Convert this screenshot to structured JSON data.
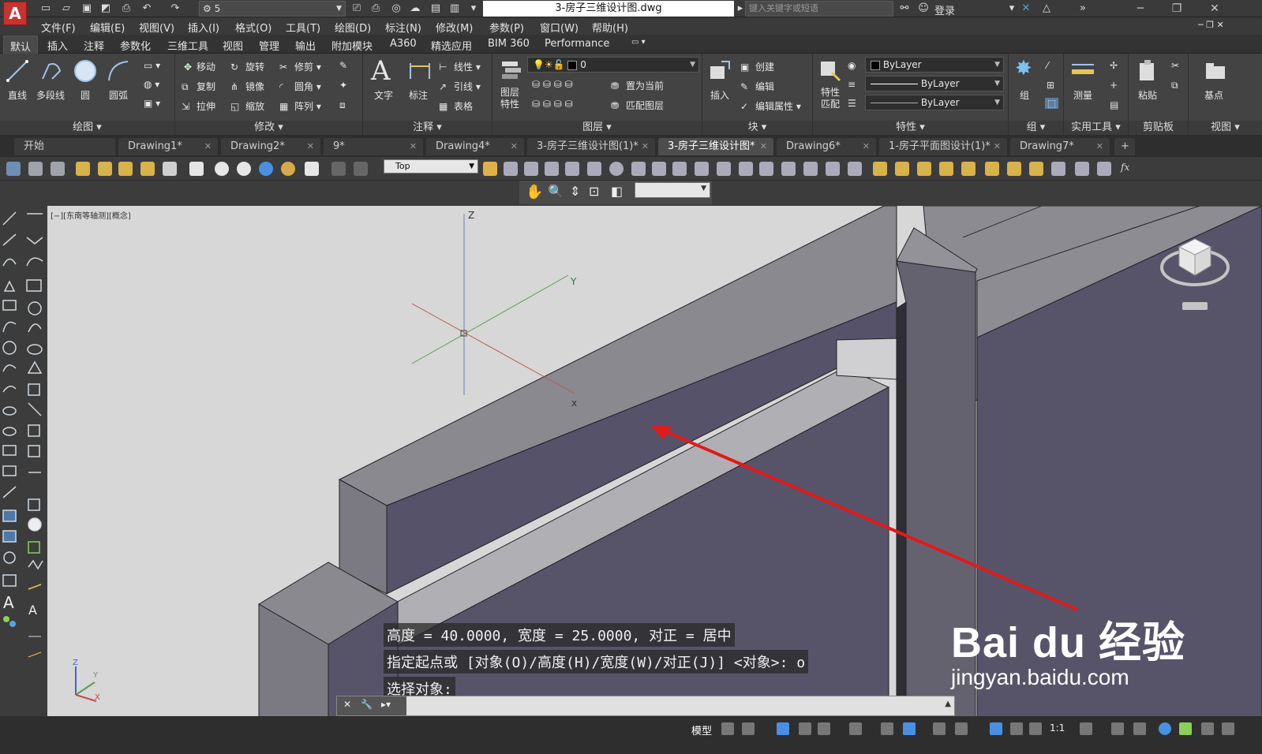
{
  "app": {
    "logo_letter": "A",
    "workspace": "5",
    "file_title": "3-房子三维设计图.dwg",
    "search_placeholder": "键入关键字或短语",
    "login": "登录"
  },
  "menu": [
    "文件(F)",
    "编辑(E)",
    "视图(V)",
    "插入(I)",
    "格式(O)",
    "工具(T)",
    "绘图(D)",
    "标注(N)",
    "修改(M)",
    "参数(P)",
    "窗口(W)",
    "帮助(H)"
  ],
  "ribbon_tabs": [
    "默认",
    "插入",
    "注释",
    "参数化",
    "三维工具",
    "视图",
    "管理",
    "输出",
    "附加模块",
    "A360",
    "精选应用",
    "BIM 360",
    "Performance"
  ],
  "ribbon": {
    "draw": {
      "title": "绘图",
      "line": "直线",
      "polyline": "多段线",
      "circle": "圆",
      "arc": "圆弧"
    },
    "modify": {
      "title": "修改",
      "move": "移动",
      "rotate": "旋转",
      "trim": "修剪",
      "copy": "复制",
      "mirror": "镜像",
      "fillet": "圆角",
      "stretch": "拉伸",
      "scale": "缩放",
      "array": "阵列"
    },
    "annotation": {
      "title": "注释",
      "text": "文字",
      "dimension": "标注",
      "linear": "线性",
      "leader": "引线",
      "table": "表格"
    },
    "layers": {
      "title": "图层",
      "layer_props": "图层\n特性",
      "layer_current": "0",
      "make_current": "置为当前",
      "match_layer": "匹配图层"
    },
    "block": {
      "title": "块",
      "insert": "插入",
      "create": "创建",
      "edit": "编辑",
      "edit_attr": "编辑属性"
    },
    "properties": {
      "title": "特性",
      "match": "特性\n匹配",
      "color": "ByLayer",
      "linetype": "ByLayer",
      "lineweight": "ByLayer"
    },
    "groups": {
      "title": "组",
      "group": "组"
    },
    "utilities": {
      "title": "实用工具",
      "measure": "测量"
    },
    "clipboard": {
      "title": "剪贴板",
      "paste": "粘贴"
    },
    "view": {
      "title": "视图",
      "base": "基点"
    }
  },
  "doc_tabs": [
    {
      "label": "开始",
      "active": false
    },
    {
      "label": "Drawing1*",
      "active": false
    },
    {
      "label": "Drawing2*",
      "active": false
    },
    {
      "label": "9*",
      "active": false
    },
    {
      "label": "Drawing4*",
      "active": false
    },
    {
      "label": "3-房子三维设计图(1)*",
      "active": false
    },
    {
      "label": "3-房子三维设计图*",
      "active": true
    },
    {
      "label": "Drawing6*",
      "active": false
    },
    {
      "label": "1-房子平面图设计(1)*",
      "active": false
    },
    {
      "label": "Drawing7*",
      "active": false
    }
  ],
  "toolbar": {
    "view_name": "Top"
  },
  "viewport": {
    "label": "[−][东南等轴测][概念]",
    "axis_z": "Z",
    "axis_y": "Y",
    "ucs_z": "Z",
    "ucs_y": "Y",
    "ucs_x": "X"
  },
  "command": {
    "history": [
      "高度 = 40.0000, 宽度 = 25.0000, 对正 = 居中",
      "指定起点或 [对象(O)/高度(H)/宽度(W)/对正(J)] <对象>: o",
      "选择对象:"
    ],
    "input": ""
  },
  "status": {
    "model": "模型",
    "scale": "1:1"
  },
  "watermark": {
    "brand": "Bai du 经验",
    "url": "jingyan.baidu.com"
  },
  "colors": {
    "accent": "#c8322f",
    "ribbon_bg": "#434343",
    "canvas_bg": "#d7d7d7",
    "solid_face_dark": "#575466",
    "solid_face_light": "#8a8990",
    "arrow": "#e11a1a"
  }
}
